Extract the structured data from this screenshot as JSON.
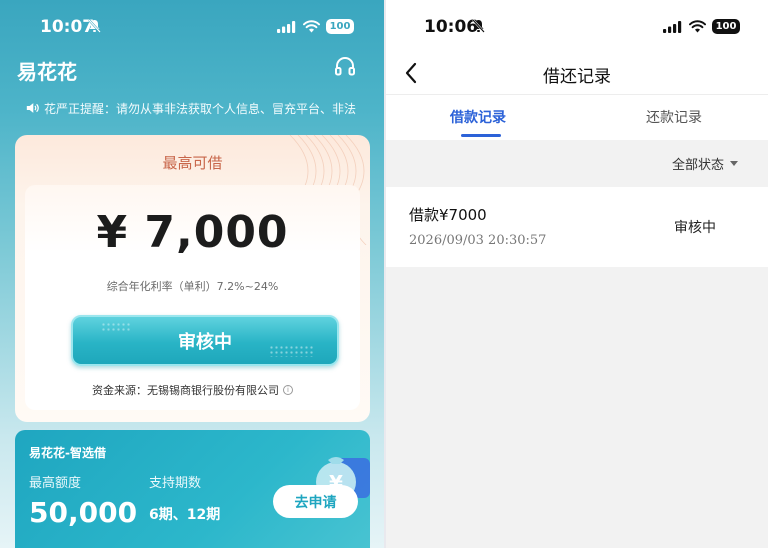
{
  "left_screen": {
    "status_bar": {
      "time": "10:07",
      "battery": "100"
    },
    "header": {
      "app_title": "易花花"
    },
    "notice": {
      "text": "花严正提醒：请勿从事非法获取个人信息、冒充平台、非法"
    },
    "credit_card": {
      "max_label": "最高可借",
      "amount": "¥ 7,000",
      "rate_text": "综合年化利率（单利）7.2%~24%",
      "button_label": "审核中",
      "funding_source": "资金来源：无锡锡商银行股份有限公司"
    },
    "promo_card": {
      "title": "易花花-智选借",
      "max_limit_label": "最高额度",
      "max_limit_value": "50,000",
      "periods_label": "支持期数",
      "periods_value": "6期、12期",
      "apply_button": "去申请"
    }
  },
  "right_screen": {
    "status_bar": {
      "time": "10:06",
      "battery": "100"
    },
    "header": {
      "title": "借还记录"
    },
    "tabs": [
      {
        "label": "借款记录",
        "active": true
      },
      {
        "label": "还款记录",
        "active": false
      }
    ],
    "filter": {
      "label": "全部状态"
    },
    "records": [
      {
        "title": "借款¥7000",
        "time": "2026/09/03 20:30:57",
        "status": "审核中"
      }
    ]
  },
  "colors": {
    "teal_primary": "#29b4c6",
    "accent_blue": "#2c62d8",
    "orange_label": "#c8664a"
  }
}
